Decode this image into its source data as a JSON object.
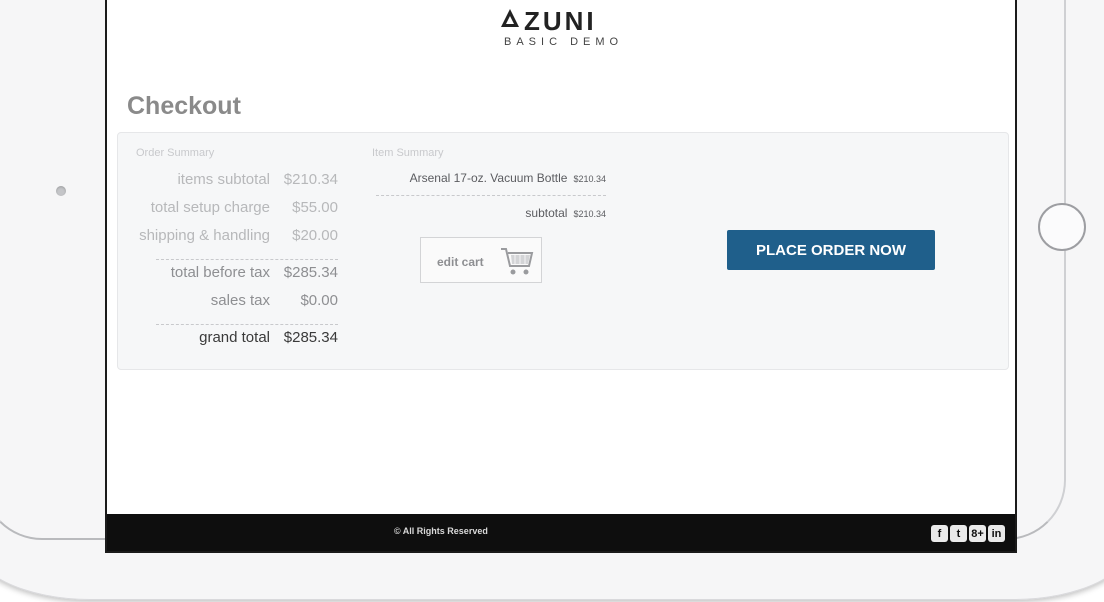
{
  "brand": {
    "name": "ZUNI",
    "subtitle": "BASIC DEMO"
  },
  "page": {
    "title": "Checkout"
  },
  "order_summary": {
    "heading": "Order Summary",
    "items_subtotal_label": "items subtotal",
    "items_subtotal_value": "$210.34",
    "setup_label": "total setup charge",
    "setup_value": "$55.00",
    "shipping_label": "shipping & handling",
    "shipping_value": "$20.00",
    "before_tax_label": "total before tax",
    "before_tax_value": "$285.34",
    "sales_tax_label": "sales tax",
    "sales_tax_value": "$0.00",
    "grand_total_label": "grand total",
    "grand_total_value": "$285.34"
  },
  "item_summary": {
    "heading": "Item Summary",
    "items": [
      {
        "name": "Arsenal 17-oz. Vacuum Bottle",
        "price": "$210.34"
      }
    ],
    "subtotal_label": "subtotal",
    "subtotal_value": "$210.34"
  },
  "actions": {
    "edit_cart_label": "edit cart",
    "edit_cart_icon": "shopping-cart-icon",
    "place_order_label": "PLACE ORDER NOW"
  },
  "footer": {
    "copyright": "© All Rights Reserved",
    "social": [
      {
        "icon": "facebook-icon",
        "glyph": "f"
      },
      {
        "icon": "twitter-icon",
        "glyph": "t"
      },
      {
        "icon": "google-plus-icon",
        "glyph": "8+"
      },
      {
        "icon": "linkedin-icon",
        "glyph": "in"
      }
    ]
  },
  "colors": {
    "primary_button": "#1f5f8b",
    "footer_bg": "#0e0e0e",
    "panel_bg": "#f6f7f8"
  }
}
